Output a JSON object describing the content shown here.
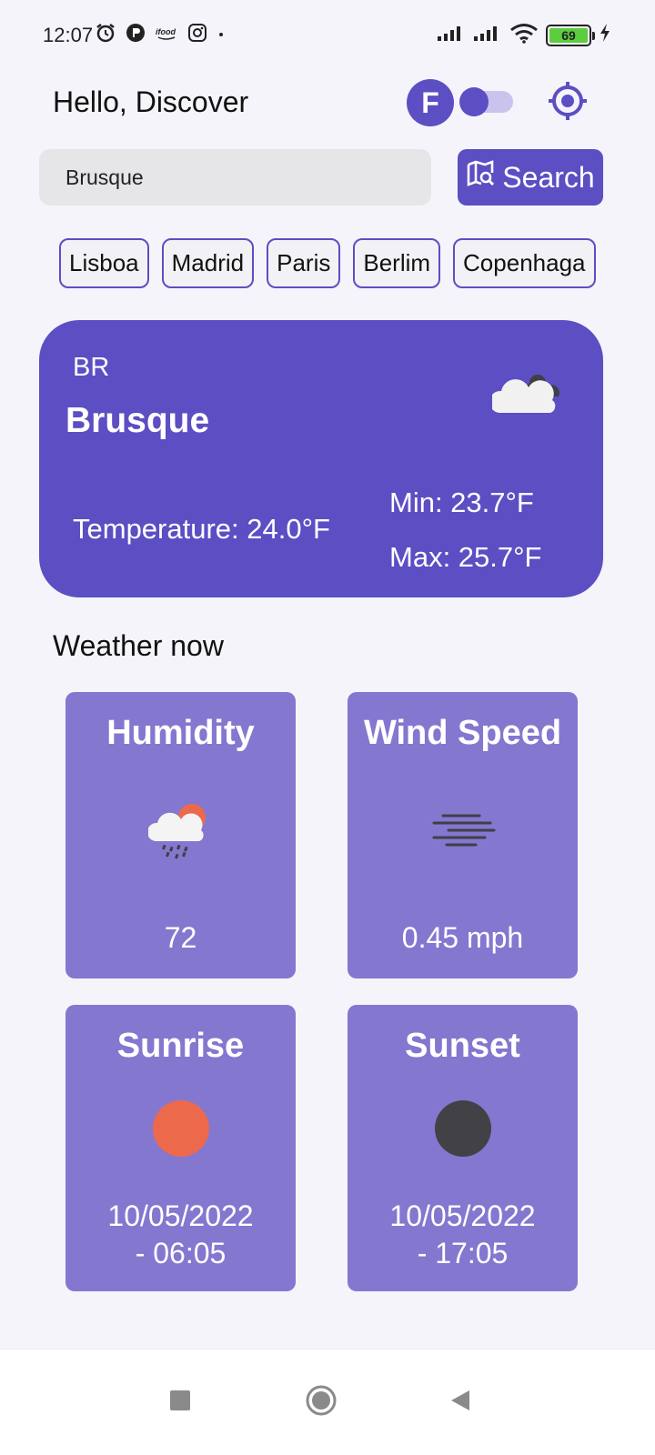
{
  "status_bar": {
    "time": "12:07",
    "battery_level": "69",
    "icons": [
      "alarm-icon",
      "app-notification-icon",
      "ifood-icon",
      "instagram-icon",
      "signal-icon",
      "wifi-icon",
      "battery-icon",
      "charging-icon"
    ]
  },
  "header": {
    "greeting": "Hello, Discover",
    "unit_badge": "F",
    "unit_toggle_on": false
  },
  "search": {
    "value": "Brusque",
    "placeholder": "",
    "button_label": "Search"
  },
  "quick_cities": [
    "Lisboa",
    "Madrid",
    "Paris",
    "Berlim",
    "Copenhaga"
  ],
  "current": {
    "country": "BR",
    "city": "Brusque",
    "temperature": "Temperature: 24.0°F",
    "min": "Min: 23.7°F",
    "max": "Max: 25.7°F",
    "icon": "cloudy-icon"
  },
  "weather_now": {
    "title": "Weather now",
    "humidity": {
      "label": "Humidity",
      "value": "72",
      "icon": "rain-cloud-sun-icon"
    },
    "wind": {
      "label": "Wind Speed",
      "value": "0.45 mph",
      "icon": "wind-lines-icon"
    },
    "sunrise": {
      "label": "Sunrise",
      "date": "10/05/2022",
      "time": "- 06:05",
      "color": "#ec6a4b"
    },
    "sunset": {
      "label": "Sunset",
      "date": "10/05/2022",
      "time": "- 17:05",
      "color": "#424246"
    }
  },
  "colors": {
    "primary": "#5c4ec3",
    "tile": "#8477d0",
    "background": "#f5f4fb"
  }
}
